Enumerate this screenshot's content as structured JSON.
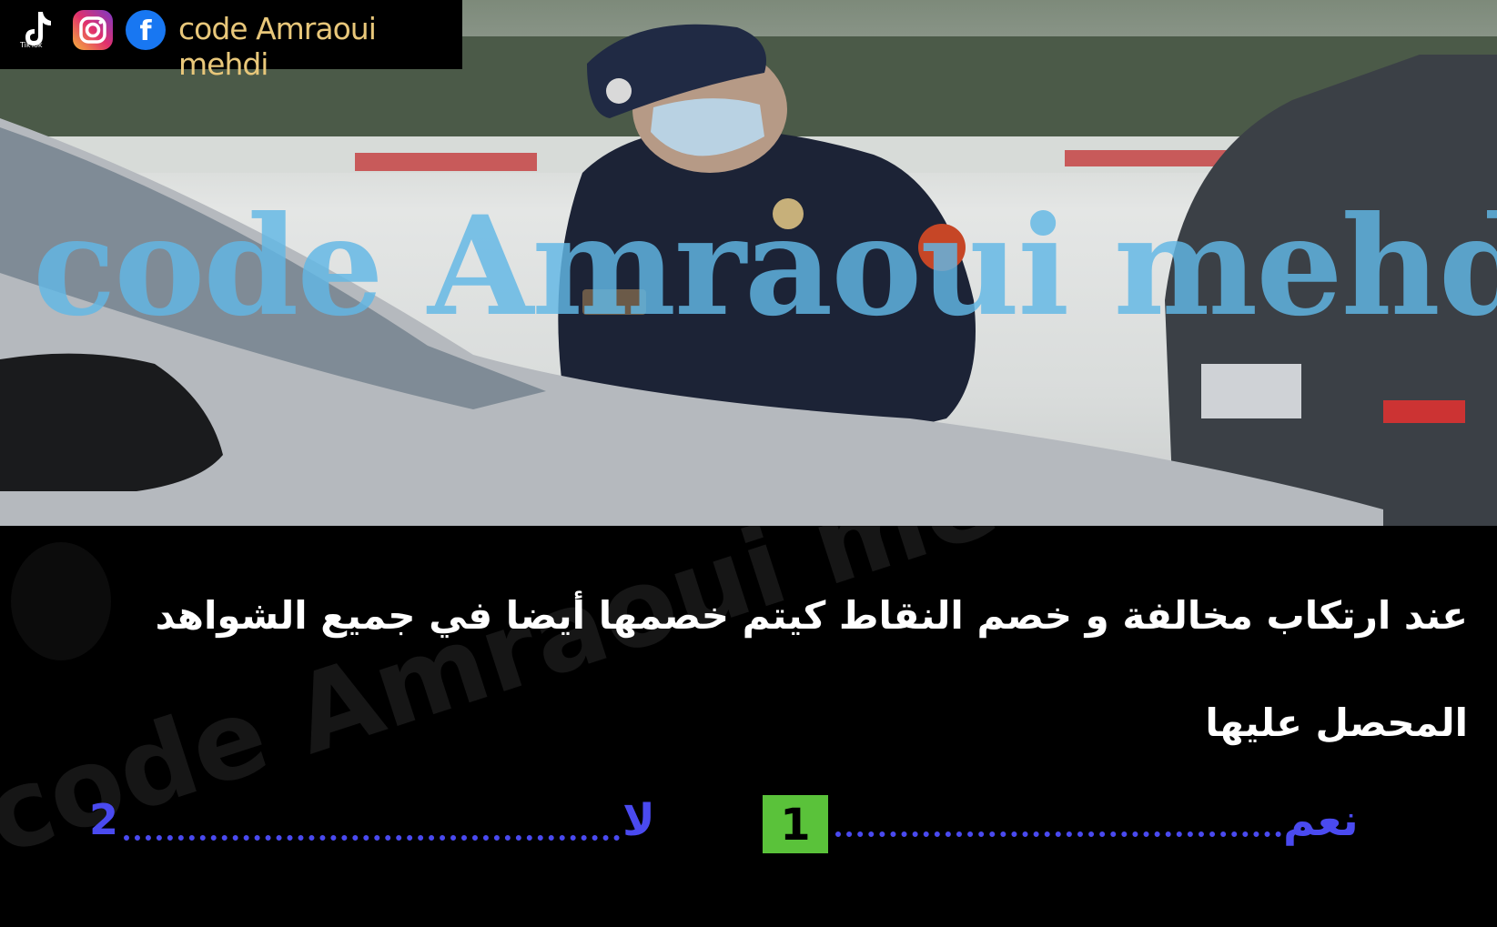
{
  "brand": {
    "name": "code Amraoui mehdi",
    "tiktok_caption": "TikTok",
    "icons": [
      "tiktok-icon",
      "instagram-icon",
      "facebook-icon"
    ],
    "facebook_glyph": "f"
  },
  "photo": {
    "watermark": "code Amraoui mehdi"
  },
  "caption": {
    "watermark": "code Amraoui mehdi",
    "question": "عند ارتكاب مخالفة و خصم النقاط كيتم خصمها أيضا في جميع الشواهد المحصل عليها"
  },
  "answers": [
    {
      "label": "نعم",
      "key": "1",
      "selected": true
    },
    {
      "label": "لا",
      "key": "2",
      "selected": false
    }
  ],
  "colors": {
    "answer_text": "#4a4af0",
    "selected_key_bg": "#5ac23a",
    "brand_text": "#e8c77a",
    "watermark": "#62b8e6"
  }
}
